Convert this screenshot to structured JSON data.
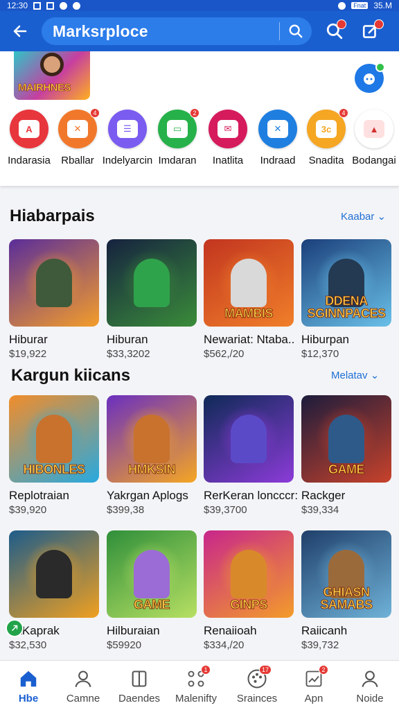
{
  "status": {
    "time": "12:30",
    "right": "35.M",
    "battery": "Fnat"
  },
  "header": {
    "search_text": "Marksrploce"
  },
  "banner": {
    "text": "MAIRHNES"
  },
  "apps": [
    {
      "label": "Indarasia",
      "color": "#e8363d",
      "glyph": "A",
      "badge": ""
    },
    {
      "label": "Rballar",
      "color": "#f1782b",
      "glyph": "✕",
      "badge": "4"
    },
    {
      "label": "Indelyarcin",
      "color": "#7b5cf0",
      "glyph": "☰",
      "badge": ""
    },
    {
      "label": "Imdaran",
      "color": "#27b14a",
      "glyph": "▭",
      "badge": "2"
    },
    {
      "label": "Inatlita",
      "color": "#d61b5d",
      "glyph": "✉",
      "badge": ""
    },
    {
      "label": "Indraad",
      "color": "#1f7fe0",
      "glyph": "✕",
      "badge": ""
    },
    {
      "label": "Snadita",
      "color": "#f5a623",
      "glyph": "3c",
      "badge": "4"
    },
    {
      "label": "Bodangai",
      "color": "#ffffff",
      "glyph": "▲",
      "badge": ""
    }
  ],
  "sections": [
    {
      "title": "Hiabarpais",
      "more": "Kaabar",
      "items": [
        {
          "name": "Hiburar",
          "price": "$19,922",
          "thumb_text": "",
          "bg": [
            "#5a2d9a",
            "#f49d2a"
          ],
          "fig": "#3f5a3a"
        },
        {
          "name": "Hiburan",
          "price": "$33,3202",
          "thumb_text": "",
          "bg": [
            "#16223f",
            "#3a8c3a"
          ],
          "fig": "#2fa34b"
        },
        {
          "name": "Newariat: Ntaba..",
          "price": "$562,/20",
          "thumb_text": "MAMBIS",
          "bg": [
            "#c2351f",
            "#f07f2a"
          ],
          "fig": "#d9d9d9"
        },
        {
          "name": "Hiburpan",
          "price": "$12,370",
          "thumb_text": "DDENA SGINNPACES",
          "bg": [
            "#1b3f7a",
            "#69c0e8"
          ],
          "fig": "#233a52"
        }
      ]
    },
    {
      "title": "Kargun kiicans",
      "more": "Melatav",
      "items": [
        {
          "name": "Replotraian",
          "price": "$39,920",
          "thumb_text": "HIBONLES",
          "bg": [
            "#f28d2a",
            "#27a9e0"
          ],
          "fig": "#c8722e"
        },
        {
          "name": "Yakrgan Aplogs",
          "price": "$399,38",
          "thumb_text": "HMKSIN",
          "bg": [
            "#6a2fc0",
            "#f5a623"
          ],
          "fig": "#c8722e"
        },
        {
          "name": "RerKeran loncccr:",
          "price": "$39,3700",
          "thumb_text": "",
          "bg": [
            "#0f2a57",
            "#8b3bd8"
          ],
          "fig": "#5b4ac8"
        },
        {
          "name": "Rackger",
          "price": "$39,334",
          "thumb_text": "GAME",
          "bg": [
            "#1c1c3c",
            "#c8422b"
          ],
          "fig": "#2e5a8a"
        }
      ]
    },
    {
      "title": "",
      "more": "",
      "items": [
        {
          "name": "baKaprak",
          "price": "$32,530",
          "thumb_text": "",
          "bg": [
            "#1d5c8a",
            "#f0a020"
          ],
          "fig": "#2a2a2a"
        },
        {
          "name": "Hilburaian",
          "price": "$59920",
          "thumb_text": "GAME",
          "bg": [
            "#2f8f3a",
            "#b7e063"
          ],
          "fig": "#9b6cd6"
        },
        {
          "name": "Renaiioah",
          "price": "$334,/20",
          "thumb_text": "GINPS",
          "bg": [
            "#c8268b",
            "#f39c2a"
          ],
          "fig": "#d88a2a"
        },
        {
          "name": "Raiicanh",
          "price": "$39,732",
          "thumb_text": "GHIASN SAMABS",
          "bg": [
            "#1f3f6a",
            "#6fb2d8"
          ],
          "fig": "#9b6a3a"
        }
      ]
    }
  ],
  "nav": [
    {
      "label": "Hbe",
      "icon": "home-icon",
      "badge": "",
      "active": true
    },
    {
      "label": "Camne",
      "icon": "person-icon",
      "badge": "",
      "active": false
    },
    {
      "label": "Daendes",
      "icon": "cards-icon",
      "badge": "",
      "active": false
    },
    {
      "label": "Malenifty",
      "icon": "grid-icon",
      "badge": "1",
      "active": false
    },
    {
      "label": "Srainces",
      "icon": "palette-icon",
      "badge": "17",
      "active": false
    },
    {
      "label": "Apn",
      "icon": "chart-icon",
      "badge": "2",
      "active": false
    },
    {
      "label": "Noide",
      "icon": "profile-icon",
      "badge": "",
      "active": false
    }
  ]
}
